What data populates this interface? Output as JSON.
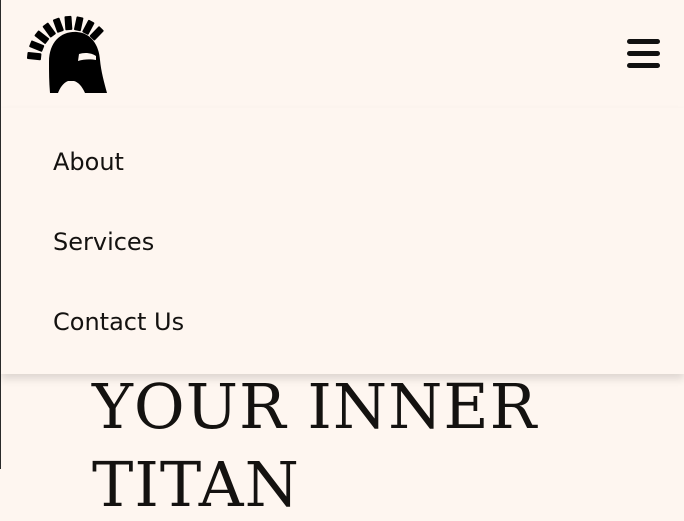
{
  "brand": {
    "logo_icon": "spartan-helmet-icon"
  },
  "nav": {
    "toggle_icon": "hamburger-menu-icon",
    "items": [
      {
        "label": "About"
      },
      {
        "label": "Services"
      },
      {
        "label": "Contact Us"
      }
    ]
  },
  "hero": {
    "line1": "YOUR INNER",
    "line2": "TITAN"
  },
  "colors": {
    "background": "#FEF6F0",
    "text": "#141210"
  }
}
